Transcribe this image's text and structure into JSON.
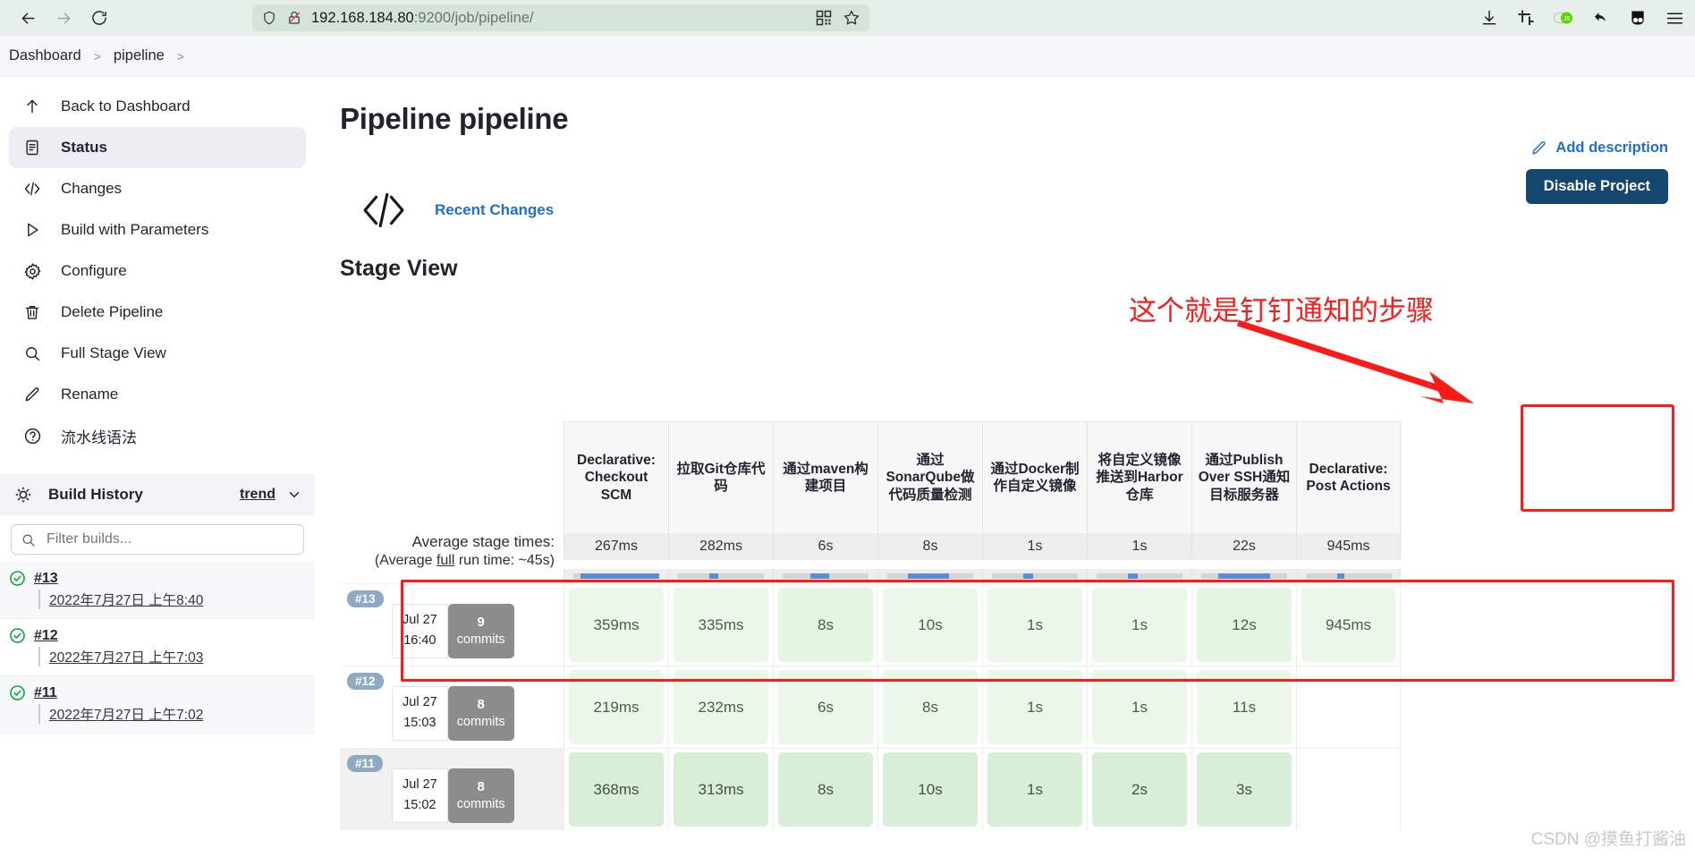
{
  "browser": {
    "back_icon": "back-arrow-icon",
    "forward_icon": "forward-arrow-icon",
    "reload_icon": "reload-icon",
    "url_host": "192.168.184.80",
    "url_rest": ":9200/job/pipeline/",
    "shield_icon": "shield-icon",
    "insecure_icon": "insecure-lock-icon",
    "qr_icon": "qr-code-icon",
    "bookmark_icon": "star-icon",
    "download_icon": "download-icon",
    "crop_icon": "crop-icon",
    "extension_icon": "extension-icon",
    "undo_icon": "undo-icon",
    "pocket_icon": "account-icon",
    "menu_icon": "hamburger-menu-icon"
  },
  "breadcrumb": {
    "items": [
      "Dashboard",
      "pipeline"
    ],
    "separator": ">"
  },
  "sidebar": {
    "items": [
      {
        "label": "Back to Dashboard",
        "icon": "up-arrow-icon",
        "active": false
      },
      {
        "label": "Status",
        "icon": "document-icon",
        "active": true
      },
      {
        "label": "Changes",
        "icon": "code-brackets-icon",
        "active": false
      },
      {
        "label": "Build with Parameters",
        "icon": "play-triangle-icon",
        "active": false
      },
      {
        "label": "Configure",
        "icon": "gear-icon",
        "active": false
      },
      {
        "label": "Delete Pipeline",
        "icon": "trash-icon",
        "active": false
      },
      {
        "label": "Full Stage View",
        "icon": "magnifier-icon",
        "active": false
      },
      {
        "label": "Rename",
        "icon": "pencil-icon",
        "active": false
      },
      {
        "label": "流水线语法",
        "icon": "question-circle-icon",
        "active": false
      }
    ],
    "build_history": {
      "title": "Build History",
      "icon": "build-history-icon",
      "trend_label": "trend",
      "chevron": "chevron-down-icon",
      "filter_placeholder": "Filter builds...",
      "filter_value": "",
      "search_icon": "search-icon",
      "builds": [
        {
          "number": "#13",
          "date": "2022年7月27日 上午8:40",
          "status": "success"
        },
        {
          "number": "#12",
          "date": "2022年7月27日 上午7:03",
          "status": "success"
        },
        {
          "number": "#11",
          "date": "2022年7月27日 上午7:02",
          "status": "success"
        }
      ]
    }
  },
  "main": {
    "page_title": "Pipeline pipeline",
    "add_description": "Add description",
    "add_description_icon": "pencil-icon",
    "disable_project": "Disable Project",
    "recent_changes": "Recent Changes",
    "recent_changes_icon": "code-brackets-icon",
    "stage_view_title": "Stage View",
    "average_label": "Average stage times:",
    "average_sub_pre": "(Average ",
    "average_sub_u": "full",
    "average_sub_post": " run time: ~45s)"
  },
  "annotations": {
    "note_text": "这个就是钉钉通知的步骤",
    "note_color": "#ff1a1a",
    "arrow": "red-arrow-icon",
    "highlight_column": "Declarative: Post Actions",
    "highlight_row": "#13"
  },
  "watermark": "CSDN @摸鱼打酱油",
  "chart_data": {
    "type": "table",
    "title": "Stage View",
    "categories": [
      "Declarative: Checkout SCM",
      "拉取Git仓库代码",
      "通过maven构建项目",
      "通过SonarQube做代码质量检测",
      "通过Docker制作自定义镜像",
      "将自定义镜像推送到Harbor仓库",
      "通过Publish Over SSH通知目标服务器",
      "Declarative: Post Actions"
    ],
    "average_times": [
      "267ms",
      "282ms",
      "6s",
      "8s",
      "1s",
      "1s",
      "22s",
      "945ms"
    ],
    "average_bar_pct": [
      92,
      10,
      22,
      48,
      12,
      12,
      60,
      8
    ],
    "rows": [
      {
        "build": "#13",
        "date": "Jul 27",
        "time": "16:40",
        "commits_count": "9",
        "commits_label": "commits",
        "shade": "light",
        "values": [
          "359ms",
          "335ms",
          "8s",
          "10s",
          "1s",
          "1s",
          "12s",
          "945ms"
        ]
      },
      {
        "build": "#12",
        "date": "Jul 27",
        "time": "15:03",
        "commits_count": "8",
        "commits_label": "commits",
        "shade": "light",
        "values": [
          "219ms",
          "232ms",
          "6s",
          "8s",
          "1s",
          "1s",
          "11s",
          ""
        ]
      },
      {
        "build": "#11",
        "date": "Jul 27",
        "time": "15:02",
        "commits_count": "8",
        "commits_label": "commits",
        "shade": "dark",
        "values": [
          "368ms",
          "313ms",
          "8s",
          "10s",
          "1s",
          "2s",
          "3s",
          ""
        ]
      }
    ]
  }
}
